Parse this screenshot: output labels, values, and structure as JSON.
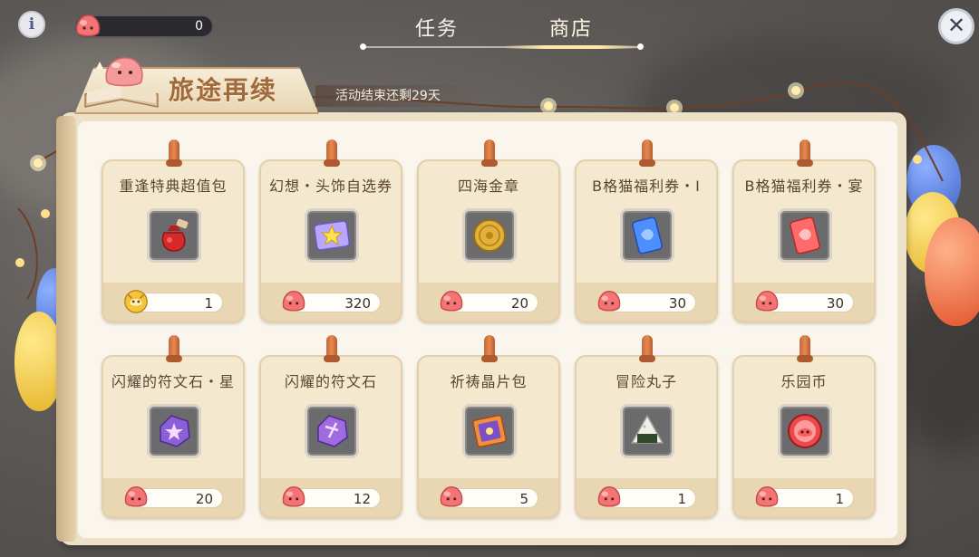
{
  "header": {
    "info_label": "i",
    "currency_value": "0",
    "tabs": [
      {
        "label": "任务",
        "active": false
      },
      {
        "label": "商店",
        "active": true
      }
    ],
    "close_label": "✕"
  },
  "banner": {
    "title": "旅途再续",
    "subtitle": "活动结束还剩29天"
  },
  "shop": {
    "items": [
      {
        "title": "重逢特典超值包",
        "price": "1",
        "currency": "special-coin-icon",
        "icon": "red-pouch-icon"
      },
      {
        "title": "幻想・头饰自选券",
        "price": "320",
        "currency": "pink-slime-icon",
        "icon": "star-ticket-icon"
      },
      {
        "title": "四海金章",
        "price": "20",
        "currency": "pink-slime-icon",
        "icon": "gold-medal-icon"
      },
      {
        "title": "B格猫福利券・I",
        "price": "30",
        "currency": "pink-slime-icon",
        "icon": "blue-ticket-icon"
      },
      {
        "title": "B格猫福利券・宴",
        "price": "30",
        "currency": "pink-slime-icon",
        "icon": "red-ticket-icon"
      },
      {
        "title": "闪耀的符文石・星",
        "price": "20",
        "currency": "pink-slime-icon",
        "icon": "rune-stone-star-icon"
      },
      {
        "title": "闪耀的符文石",
        "price": "12",
        "currency": "pink-slime-icon",
        "icon": "rune-stone-icon"
      },
      {
        "title": "祈祷晶片包",
        "price": "5",
        "currency": "pink-slime-icon",
        "icon": "crystal-pack-icon"
      },
      {
        "title": "冒险丸子",
        "price": "1",
        "currency": "pink-slime-icon",
        "icon": "rice-ball-icon"
      },
      {
        "title": "乐园币",
        "price": "1",
        "currency": "pink-slime-icon",
        "icon": "park-coin-icon"
      }
    ]
  },
  "colors": {
    "card_bg": "#f4e8cf",
    "title_text": "#5b4433",
    "banner_title": "#a06a3d",
    "slime_pink": "#f06a6a"
  }
}
